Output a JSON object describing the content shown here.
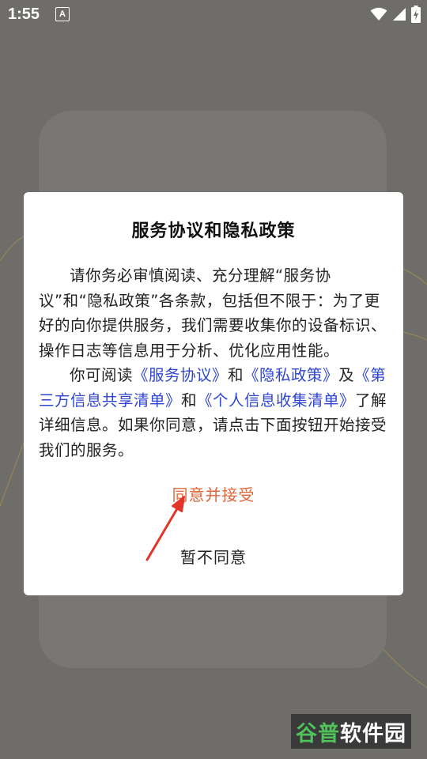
{
  "status_bar": {
    "time": "1:55",
    "notification_icon": "text-notification-icon",
    "icons": [
      "wifi-icon",
      "signal-icon",
      "battery-charging-icon"
    ]
  },
  "dialog": {
    "title": "服务协议和隐私政策",
    "paragraph1": "请你务必审慎阅读、充分理解“服务协议”和“隐私政策”各条款，包括但不限于：为了更好的向你提供服务，我们需要收集你的设备标识、操作日志等信息用于分析、优化应用性能。",
    "p2_text1": "你可阅读",
    "link_service_agreement": "《服务协议》",
    "p2_text2": "和",
    "link_privacy_policy": "《隐私政策》",
    "p2_text3": "及",
    "link_third_party_list": "《第三方信息共享清单》",
    "p2_text4": "和",
    "link_personal_info_list": "《个人信息收集清单》",
    "p2_text5": "了解详细信息。如果你同意，请点击下面按钮开始接受我们的服务。",
    "agree_label": "同意并接受",
    "decline_label": "暂不同意"
  },
  "watermark": {
    "text_green": "谷普",
    "text_white": "软件园"
  },
  "colors": {
    "link": "#2e46cf",
    "agree": "#e0683a",
    "annotation_arrow": "#e2352a"
  }
}
